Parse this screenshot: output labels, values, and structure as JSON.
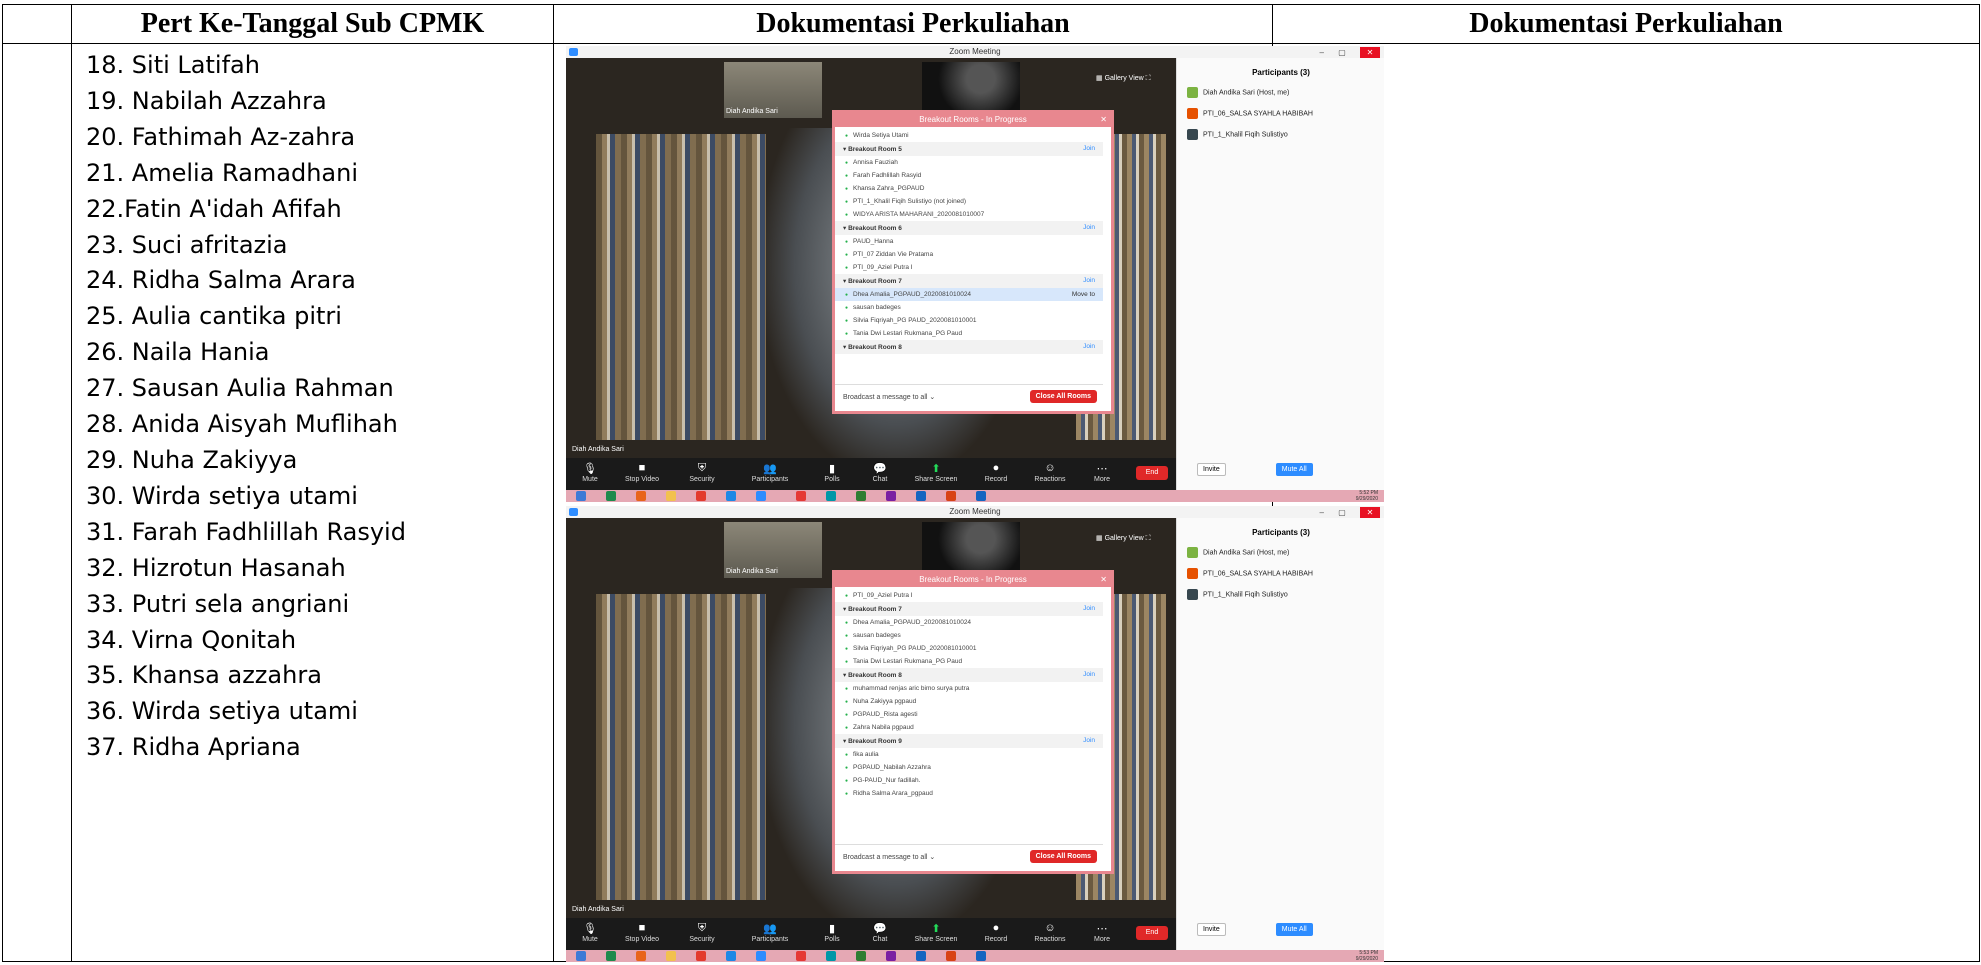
{
  "table": {
    "headers": [
      "Pert Ke-Tanggal Sub CPMK",
      "Dokumentasi Perkuliahan",
      "Dokumentasi Perkuliahan"
    ],
    "names": [
      "18. Siti Latifah",
      "19. Nabilah Azzahra",
      "20. Fathimah Az-zahra",
      "21. Amelia Ramadhani",
      "22.Fatin A'idah Afifah",
      "23. Suci afritazia",
      "24. Ridha Salma Arara",
      "25. Aulia cantika pitri",
      "26. Naila Hania",
      "27. Sausan Aulia Rahman",
      "28. Anida Aisyah Muflihah",
      "29. Nuha Zakiyya",
      "30. Wirda setiya utami",
      "31. Farah Fadhlillah Rasyid",
      "32. Hizrotun Hasanah",
      "33. Putri sela angriani",
      "34. Virna Qonitah",
      "35. Khansa azzahra",
      "36. Wirda setiya utami",
      "37. Ridha Apriana"
    ]
  },
  "zoom": {
    "window_title": "Zoom Meeting",
    "gallery_view": "Gallery View",
    "host_name": "Diah Andika Sari",
    "participants_title": "Participants (3)",
    "participants": [
      "Diah Andika Sari (Host, me)",
      "PTI_06_SALSA SYAHLA HABIBAH",
      "PTI_1_Khalil Fiqih Sulistiyo"
    ],
    "invite": "Invite",
    "mute_all": "Mute All",
    "toolbar": [
      "Mute",
      "Stop Video",
      "Security",
      "Participants",
      "Polls",
      "Chat",
      "Share Screen",
      "Record",
      "Reactions",
      "More"
    ],
    "end": "End",
    "dialog_title": "Breakout Rooms - In Progress",
    "join": "Join",
    "move_to": "Move to",
    "broadcast": "Broadcast a message to all",
    "close_all": "Close All Rooms",
    "shot1": {
      "time": "5:52 PM",
      "date": "9/29/2020",
      "rows": [
        {
          "t": "m",
          "v": "Wirda Setiya Utami"
        },
        {
          "t": "r",
          "v": "Breakout Room 5"
        },
        {
          "t": "m",
          "v": "Annisa Fauziah"
        },
        {
          "t": "m",
          "v": "Farah Fadhlillah Rasyid"
        },
        {
          "t": "m",
          "v": "Khansa Zahra_PGPAUD"
        },
        {
          "t": "m",
          "v": "PTI_1_Khalil Fiqih Sulistiyo (not joined)"
        },
        {
          "t": "m",
          "v": "WIDYA ARISTA MAHARANI_2020081010007"
        },
        {
          "t": "r",
          "v": "Breakout Room 6"
        },
        {
          "t": "m",
          "v": "PAUD_Hanna"
        },
        {
          "t": "m",
          "v": "PTI_07 Ziddan Vie Pratama"
        },
        {
          "t": "m",
          "v": "PTI_09_Aziel Putra I"
        },
        {
          "t": "r",
          "v": "Breakout Room 7"
        },
        {
          "t": "s",
          "v": "Dhea Amalia_PGPAUD_2020081010024"
        },
        {
          "t": "m",
          "v": "sausan badeges"
        },
        {
          "t": "m",
          "v": "Silvia Fiqriyah_PG PAUD_2020081010001"
        },
        {
          "t": "m",
          "v": "Tania Dwi Lestari Rukmana_PG Paud"
        },
        {
          "t": "r",
          "v": "Breakout Room 8"
        }
      ]
    },
    "shot2": {
      "time": "5:53 PM",
      "date": "9/29/2020",
      "rows": [
        {
          "t": "m",
          "v": "PTI_09_Aziel Putra I"
        },
        {
          "t": "r",
          "v": "Breakout Room 7"
        },
        {
          "t": "m",
          "v": "Dhea Amalia_PGPAUD_2020081010024"
        },
        {
          "t": "m",
          "v": "sausan badeges"
        },
        {
          "t": "m",
          "v": "Silvia Fiqriyah_PG PAUD_2020081010001"
        },
        {
          "t": "m",
          "v": "Tania Dwi Lestari Rukmana_PG Paud"
        },
        {
          "t": "r",
          "v": "Breakout Room 8"
        },
        {
          "t": "m",
          "v": "muhammad renjas aric bimo surya putra"
        },
        {
          "t": "m",
          "v": "Nuha Zakiyya pgpaud"
        },
        {
          "t": "m",
          "v": "PGPAUD_Rista agesti"
        },
        {
          "t": "m",
          "v": "Zahra Nabila pgpaud"
        },
        {
          "t": "r",
          "v": "Breakout Room 9"
        },
        {
          "t": "m",
          "v": "fika aulia"
        },
        {
          "t": "m",
          "v": "PGPAUD_Nabilah Azzahra"
        },
        {
          "t": "m",
          "v": "PG-PAUD_Nur fadillah."
        },
        {
          "t": "m",
          "v": "Ridha Salma Arara_pgpaud"
        }
      ]
    },
    "colors": {
      "dialog": "#e8878f",
      "taskbar": "#e5a8b4",
      "zoom_blue": "#2d8cff",
      "end_red": "#e02828"
    }
  }
}
